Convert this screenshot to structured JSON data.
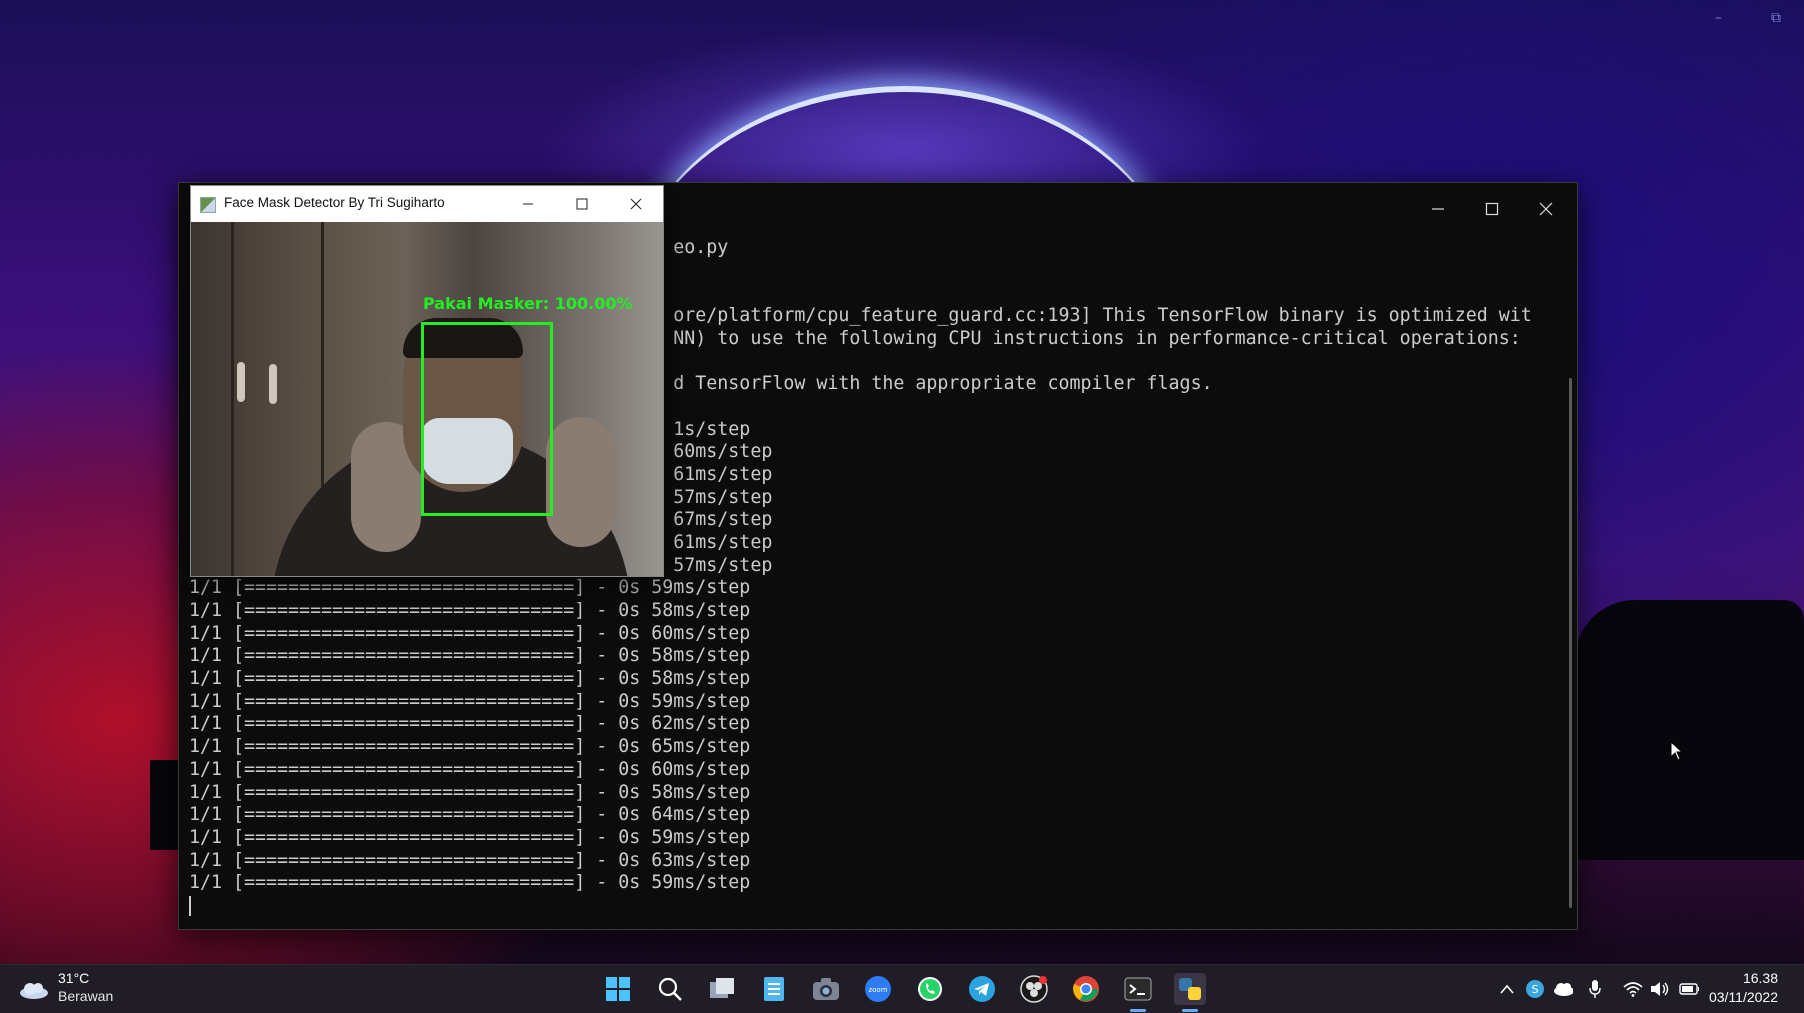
{
  "desktop": {
    "corner_minimize": "–",
    "corner_restore": "⧉"
  },
  "terminal": {
    "minimize_icon": "minimize-icon",
    "maximize_icon": "maximize-icon",
    "close_icon": "close-icon",
    "lines": [
      "                                            eo.py",
      "",
      "",
      "                                            ore/platform/cpu_feature_guard.cc:193] This TensorFlow binary is optimized wit",
      "                                            NN) to use the following CPU instructions in performance-critical operations:",
      "",
      "                                            d TensorFlow with the appropriate compiler flags.",
      "",
      "                                            1s/step",
      "                                            60ms/step",
      "                                            61ms/step",
      "                                            57ms/step",
      "                                            67ms/step",
      "                                            61ms/step",
      "                                            57ms/step",
      "1/1 [==============================] - 0s 59ms/step",
      "1/1 [==============================] - 0s 58ms/step",
      "1/1 [==============================] - 0s 60ms/step",
      "1/1 [==============================] - 0s 58ms/step",
      "1/1 [==============================] - 0s 58ms/step",
      "1/1 [==============================] - 0s 59ms/step",
      "1/1 [==============================] - 0s 62ms/step",
      "1/1 [==============================] - 0s 65ms/step",
      "1/1 [==============================] - 0s 60ms/step",
      "1/1 [==============================] - 0s 58ms/step",
      "1/1 [==============================] - 0s 64ms/step",
      "1/1 [==============================] - 0s 59ms/step",
      "1/1 [==============================] - 0s 63ms/step",
      "1/1 [==============================] - 0s 59ms/step"
    ]
  },
  "camera_window": {
    "title": "Face Mask Detector By Tri Sugiharto",
    "detection_label": "Pakai Masker: 100.00%",
    "detection_color": "#22ee22"
  },
  "taskbar": {
    "weather_temp": "31°C",
    "weather_desc": "Berawan",
    "clock_time": "16.38",
    "clock_date": "03/11/2022",
    "apps": [
      "start-icon",
      "search-icon",
      "task-view-icon",
      "notepad-icon",
      "camera-icon",
      "zoom-icon",
      "whatsapp-icon",
      "telegram-icon",
      "obs-icon",
      "chrome-icon",
      "terminal-icon",
      "python-icon"
    ],
    "tray": [
      "chevron-up-icon",
      "skype-icon",
      "onedrive-icon",
      "microphone-icon",
      "wifi-icon",
      "volume-icon",
      "battery-icon"
    ],
    "zoom_label": "zoom"
  }
}
